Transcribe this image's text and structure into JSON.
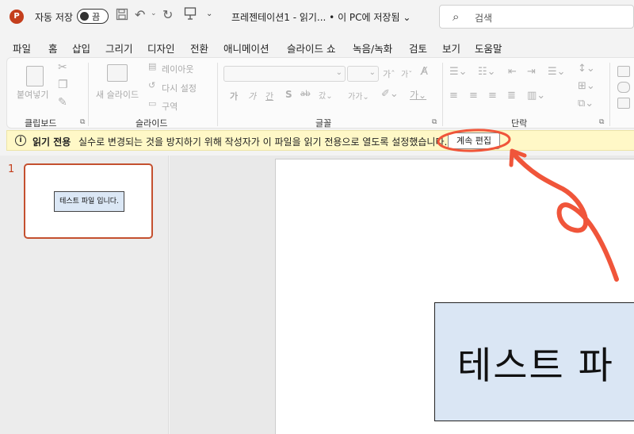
{
  "titlebar": {
    "app_logo": "P",
    "autosave_label": "자동 저장",
    "autosave_state": "끔",
    "doc_title": "프레젠테이션1  -  읽기...  • 이 PC에 저장됨 ⌄",
    "search_placeholder": "검색",
    "icons": [
      "save-icon",
      "undo-icon",
      "redo-icon",
      "present-icon",
      "customize-icon"
    ]
  },
  "menu": {
    "tabs": [
      "파일",
      "홈",
      "삽입",
      "그리기",
      "디자인",
      "전환",
      "애니메이션",
      "슬라이드 쇼",
      "녹음/녹화",
      "검토",
      "보기",
      "도움말"
    ],
    "active": "홈"
  },
  "ribbon": {
    "clipboard": {
      "label": "클립보드",
      "paste": "붙여넣기"
    },
    "slides": {
      "label": "슬라이드",
      "new_slide": "새 슬라이드",
      "layout": "레이아웃",
      "reset": "다시 설정",
      "section": "구역"
    },
    "font": {
      "label": "글꼴"
    },
    "paragraph": {
      "label": "단락"
    }
  },
  "infobar": {
    "title": "읽기 전용",
    "message": "실수로 변경되는 것을 방지하기 위해 작성자가 이 파일을 읽기 전용으로 열도록 설정했습니다.",
    "button": "계속 편집"
  },
  "thumbs": {
    "number": "1",
    "thumb_text": "테스트 파일 입니다."
  },
  "slide": {
    "text": "테스트 파"
  },
  "colors": {
    "accent": "#c43e1c",
    "infobar_bg": "#fff8c7",
    "annotation": "#f0553a",
    "textbox_fill": "#dae6f4"
  }
}
